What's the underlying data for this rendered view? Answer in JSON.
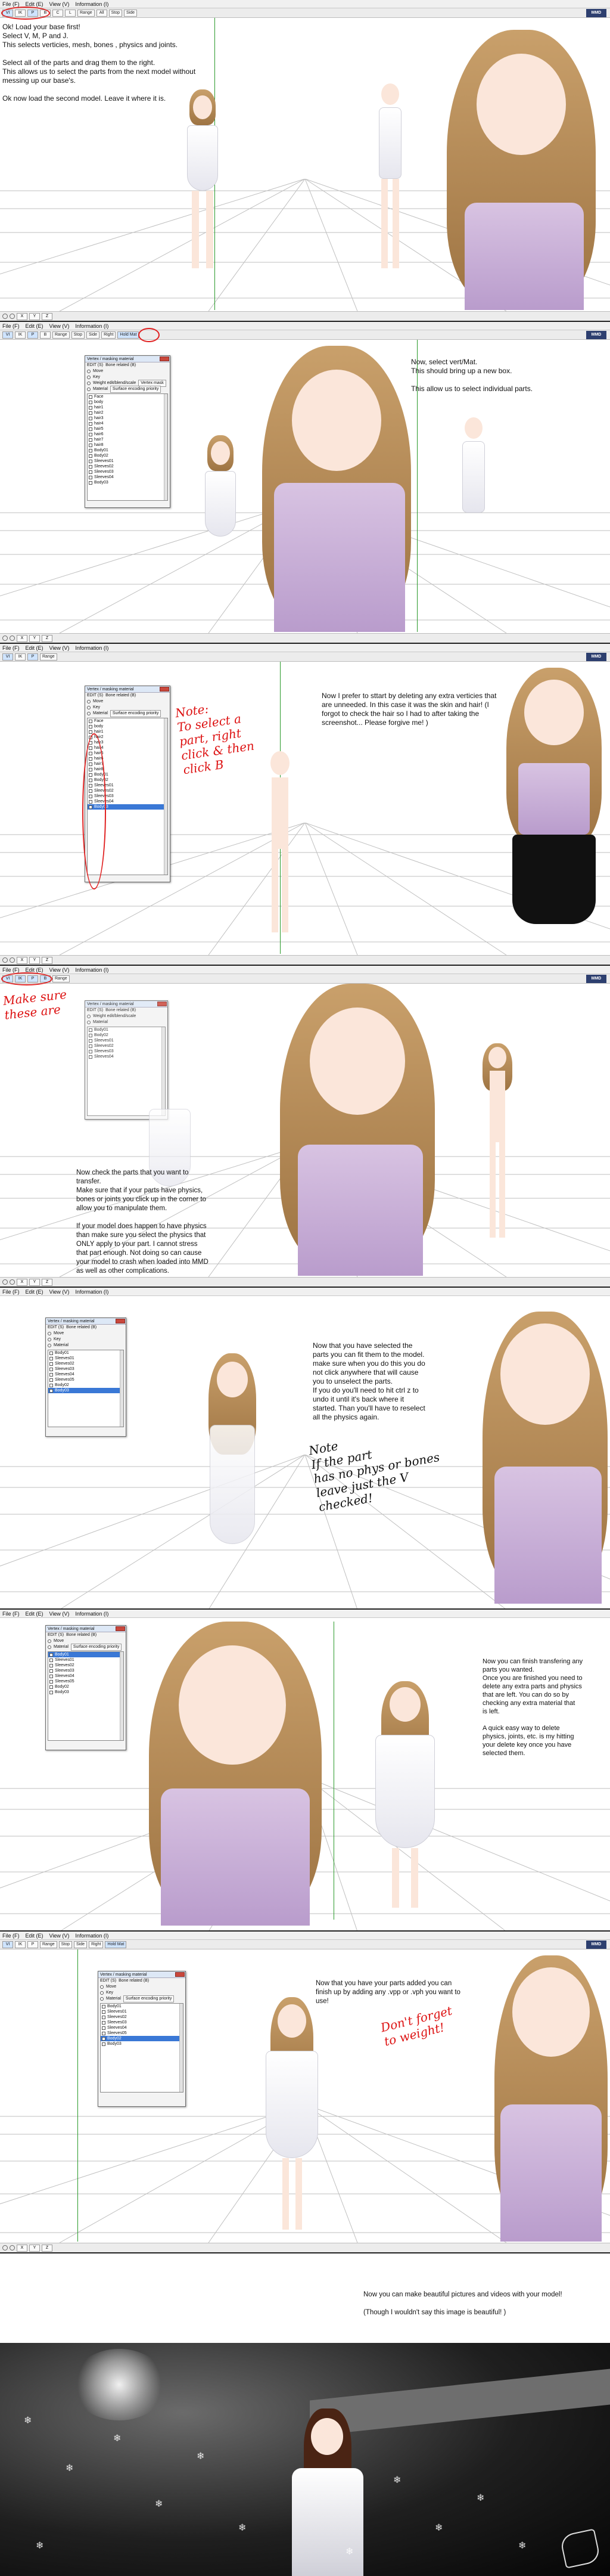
{
  "menu": {
    "file": "File (F)",
    "edit": "Edit (E)",
    "view": "View (V)",
    "info": "Information (I)"
  },
  "toolbar": {
    "icons": [
      "VI",
      "IK",
      "P",
      "B",
      "C",
      "L"
    ],
    "range": "Range",
    "all": "All",
    "view_buttons": [
      "Stop",
      "Side",
      "Right",
      "Hold Mat"
    ],
    "axes": [
      "X",
      "Y",
      "Z"
    ],
    "logo": "MMD"
  },
  "dialog": {
    "title": "Vertex / masking material",
    "edit_label": "EDIT (S)",
    "bone_label": "Bone related (B)",
    "options": [
      "Move",
      "Key",
      "Weight edit/blend/scale",
      "Material"
    ],
    "extra_buttons": [
      "Vertex mask",
      "Surface encoding priority"
    ],
    "parts_short": [
      "Face",
      "body",
      "hair1",
      "hair2",
      "hair3",
      "hair4",
      "hair5",
      "hair6",
      "hair7",
      "hair8",
      "Body01",
      "Body02",
      "Sleeves01",
      "Sleeves02",
      "Sleeves03",
      "Sleeves04",
      "Body03"
    ],
    "parts_model2": [
      "Body01",
      "Sleeves01",
      "Sleeves02",
      "Sleeves03",
      "Sleeves04",
      "Sleeves05",
      "Body02",
      "Body03"
    ]
  },
  "panels": {
    "p1": {
      "text": "Ok! Load your base first!\nSelect V, M, P and J.\nThis selects verticies, mesh, bones , physics and joints.\n\nSelect all of the parts and drag them to the right.\nThis allows us to select the parts from the next model without\nmessing up our base's.\n\nOk now load the second model. Leave it where it is."
    },
    "p2": {
      "text": "Now, select vert/Mat.\nThis should bring up a new box.\n\nThis allow us to select individual parts."
    },
    "p3": {
      "text": "Now I prefer to sttart by deleting any extra verticies that\nare unneeded. In this case it was the skin and hair! (I\nforgot to check the hair so I had to after taking the\nscreenshot... Please forgive me! )",
      "note": "Note:\nTo select a\npart, right\nclick & then\nclick B"
    },
    "p4": {
      "text": "Now check the parts that you want to\ntransfer.\nMake sure that if your parts have physics,\nbones or joints you click up in the corner to\nallow you to manipulate them.\n\nIf your model does happen to have physics\nthan make sure you select the physics that\nONLY apply to your part. I cannot stress\nthat part enough. Not doing so can cause\nyour model to crash when loaded into MMD\nas well as other complications.",
      "note": "Make sure\nthese are"
    },
    "p5": {
      "text": "Now that you have selected the\nparts you can fit them to the model.\nmake sure when you do this you do\nnot click anywhere that will cause\nyou to unselect the parts.\nIf you do you'll need to hit ctrl z to\nundo it until it's back where it\nstarted. Than you'll have to reselect\nall the physics again.",
      "note": "Note\nIf the part\nhas no phys or bones\nleave just the V\nchecked!"
    },
    "p6": {
      "text": "Now you can finish transfering any\nparts you wanted.\nOnce you are finished you need to\ndelete any extra parts and physics\nthat are left. You can do so by\nchecking any extra material that\nis left.\n\nA quick easy way to delete\nphysics, joints, etc. is my hitting\nyour delete key once you have\nselected them."
    },
    "p7": {
      "text": "Now that you have your parts added you can\nfinish up by adding any .vpp or .vph you want to\nuse!",
      "note": "Don't forget\nto weight!"
    },
    "p8": {
      "text": "Now you can make beautiful pictures and videos with your model!\n\n(Though I wouldn't say this image is beautiful! )"
    }
  },
  "colors": {
    "accent_red": "#e02020",
    "grid": "#bfbfbf",
    "axis_green": "#2a9a2a",
    "dress": "#c8b0d6"
  }
}
